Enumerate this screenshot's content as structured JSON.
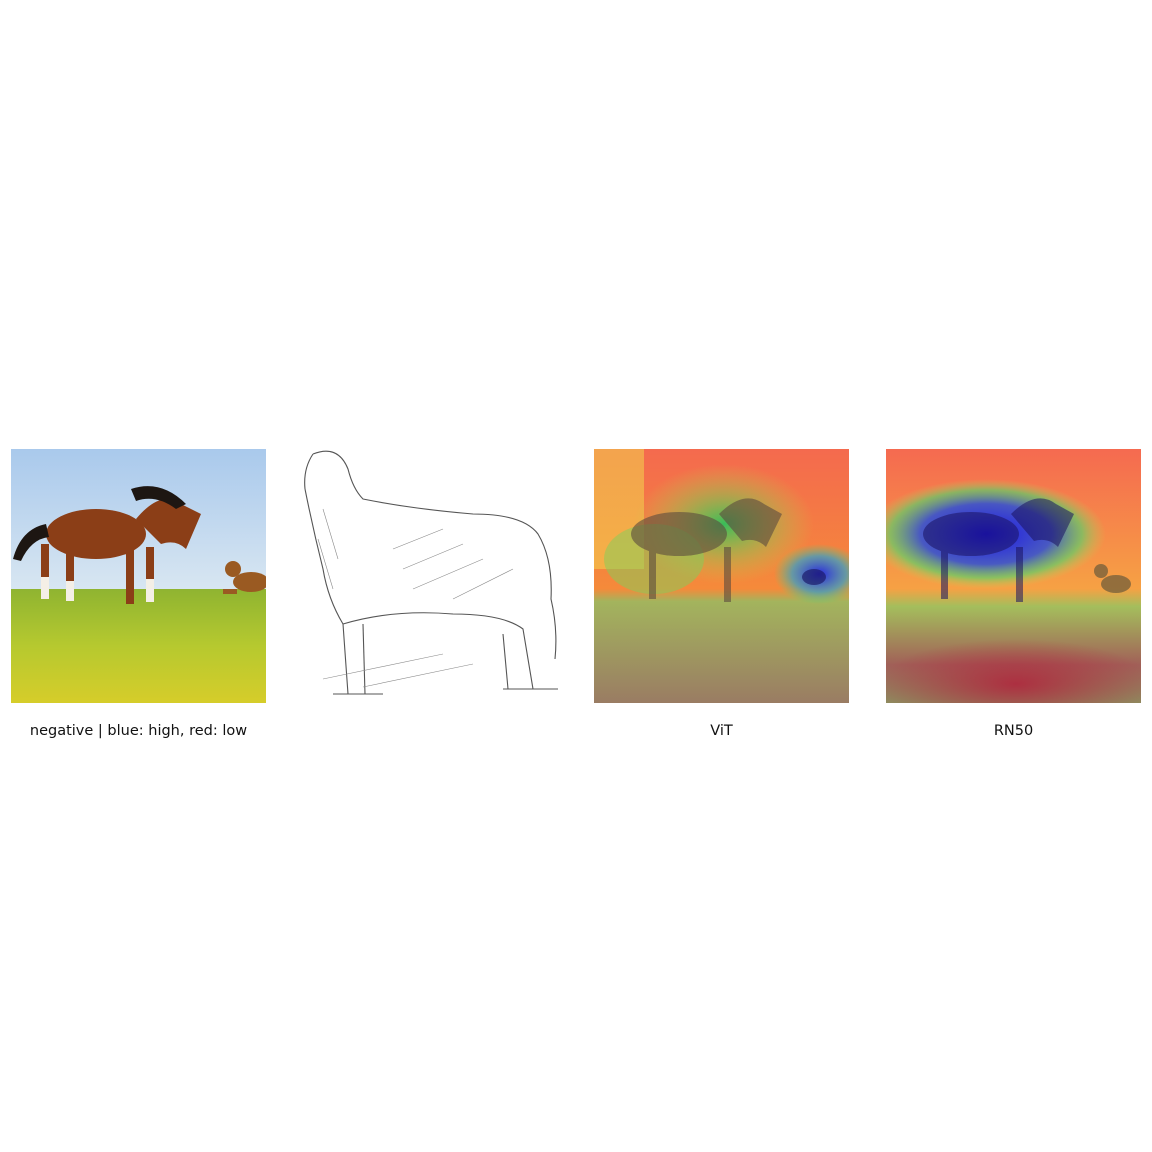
{
  "figure": {
    "panels": [
      {
        "caption": "negative | blue: high, red: low",
        "content_icon": "horse-and-dog-photo-icon"
      },
      {
        "caption": "",
        "content_icon": "dog-sketch-icon"
      },
      {
        "caption": "ViT",
        "content_icon": "vit-heatmap-icon"
      },
      {
        "caption": "RN50",
        "content_icon": "rn50-heatmap-icon"
      }
    ],
    "colors": {
      "heat_high": "#1a1aff",
      "heat_low": "#ff3030",
      "sky": "#b7d3ee",
      "grass": "#b9cc3a",
      "horse": "#8a3f18",
      "dog": "#9a5a22"
    }
  }
}
